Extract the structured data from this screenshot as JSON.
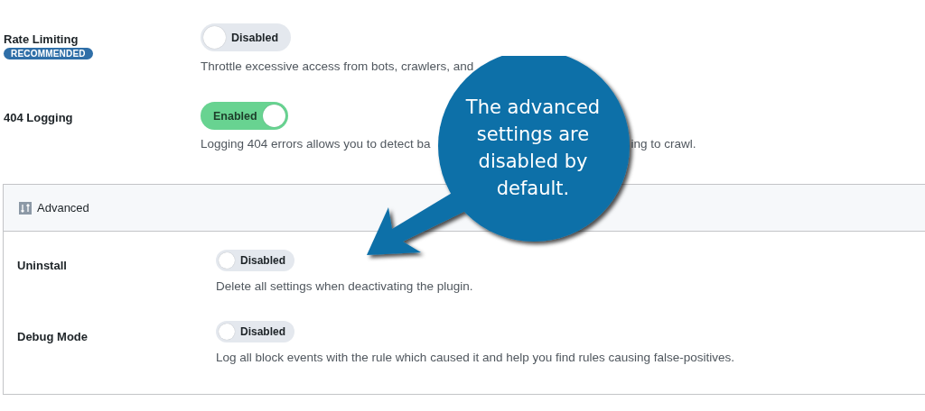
{
  "settings": [
    {
      "label": "Rate Limiting",
      "badge": "RECOMMENDED",
      "toggle": {
        "on": false,
        "text": "Disabled"
      },
      "description": [
        "Throttle excessive access from bots, crawlers, and"
      ]
    },
    {
      "label": "404 Logging",
      "toggle": {
        "on": true,
        "text": "Enabled"
      },
      "description": [
        "Logging 404 errors allows you to detect ba",
        "ing to crawl."
      ]
    }
  ],
  "advanced": {
    "title": "Advanced",
    "settings": [
      {
        "label": "Uninstall",
        "toggle": {
          "on": false,
          "text": "Disabled"
        },
        "description": [
          "Delete all settings when deactivating the plugin."
        ]
      },
      {
        "label": "Debug Mode",
        "toggle": {
          "on": false,
          "text": "Disabled"
        },
        "description": [
          "Log all block events with the rule which caused it and help you find rules causing false-positives."
        ]
      }
    ]
  },
  "callout": {
    "text": "The advanced settings are disabled by default."
  }
}
